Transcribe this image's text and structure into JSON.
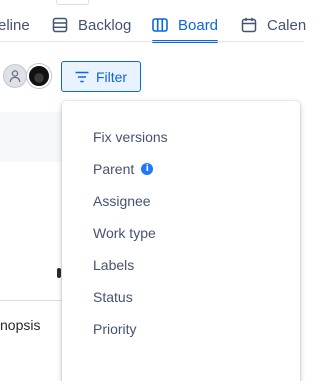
{
  "tabs": [
    {
      "label": "eline",
      "icon": "timeline-icon"
    },
    {
      "label": "Backlog",
      "icon": "backlog-icon"
    },
    {
      "label": "Board",
      "icon": "board-icon",
      "active": true
    },
    {
      "label": "Calen",
      "icon": "calendar-icon"
    }
  ],
  "toolbar": {
    "filter_label": "Filter",
    "avatars": [
      "unassigned-avatar",
      "user-avatar"
    ]
  },
  "filter_menu": {
    "items": [
      {
        "label": "Fix versions"
      },
      {
        "label": "Parent",
        "info_icon": "i"
      },
      {
        "label": "Assignee"
      },
      {
        "label": "Work type"
      },
      {
        "label": "Labels"
      },
      {
        "label": "Status"
      },
      {
        "label": "Priority"
      }
    ]
  },
  "background": {
    "row_text": "nopsis"
  },
  "colors": {
    "accent": "#0c66e4",
    "accent_bg": "#e9f2ff",
    "text": "#44546f",
    "info": "#1d7afc"
  }
}
